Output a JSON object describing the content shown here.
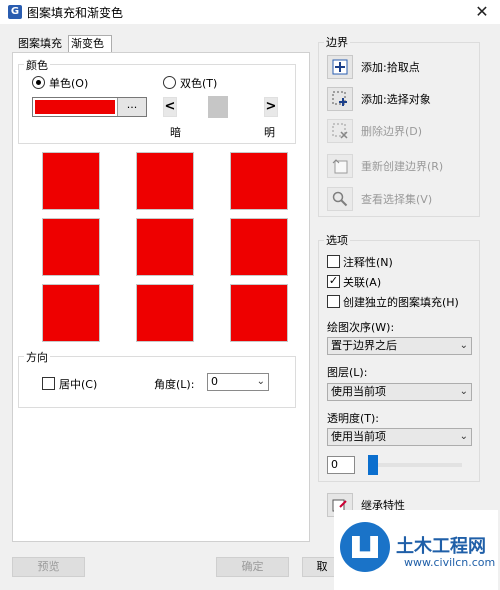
{
  "window": {
    "app_icon_letter": "G",
    "title": "图案填充和渐变色",
    "close_label": "✕"
  },
  "tabs": [
    {
      "label": "图案填充"
    },
    {
      "label": "渐变色"
    }
  ],
  "color": {
    "group_label": "颜色",
    "single_label": "单色(O)",
    "dual_label": "双色(T)",
    "selected_color": "#ee0000",
    "browse_label": "...",
    "dark_label": "暗",
    "light_label": "明",
    "left_arrow": "<",
    "right_arrow": ">"
  },
  "orientation": {
    "group_label": "方向",
    "centered_label": "居中(C)",
    "angle_label": "角度(L):",
    "angle_value": "0"
  },
  "boundaries": {
    "group_label": "边界",
    "items": [
      {
        "label": "添加:拾取点",
        "enabled": true,
        "icon": "pick-points-icon"
      },
      {
        "label": "添加:选择对象",
        "enabled": true,
        "icon": "select-objects-icon"
      },
      {
        "label": "删除边界(D)",
        "enabled": false,
        "icon": "remove-boundaries-icon"
      },
      {
        "label": "重新创建边界(R)",
        "enabled": false,
        "icon": "recreate-boundary-icon"
      },
      {
        "label": "查看选择集(V)",
        "enabled": false,
        "icon": "view-selections-icon"
      }
    ]
  },
  "options": {
    "group_label": "选项",
    "annotative_label": "注释性(N)",
    "associative_label": "关联(A)",
    "separate_label": "创建独立的图案填充(H)",
    "draw_order_label": "绘图次序(W):",
    "draw_order_value": "置于边界之后",
    "layer_label": "图层(L):",
    "layer_value": "使用当前项",
    "transparency_label": "透明度(T):",
    "transparency_value": "使用当前项",
    "transparency_number": "0"
  },
  "inherit_label": "继承特性",
  "buttons": {
    "preview": "预览",
    "ok": "确定",
    "cancel": "取"
  },
  "watermark": {
    "title": "土木工程网",
    "url": "www.civilcn.com"
  }
}
